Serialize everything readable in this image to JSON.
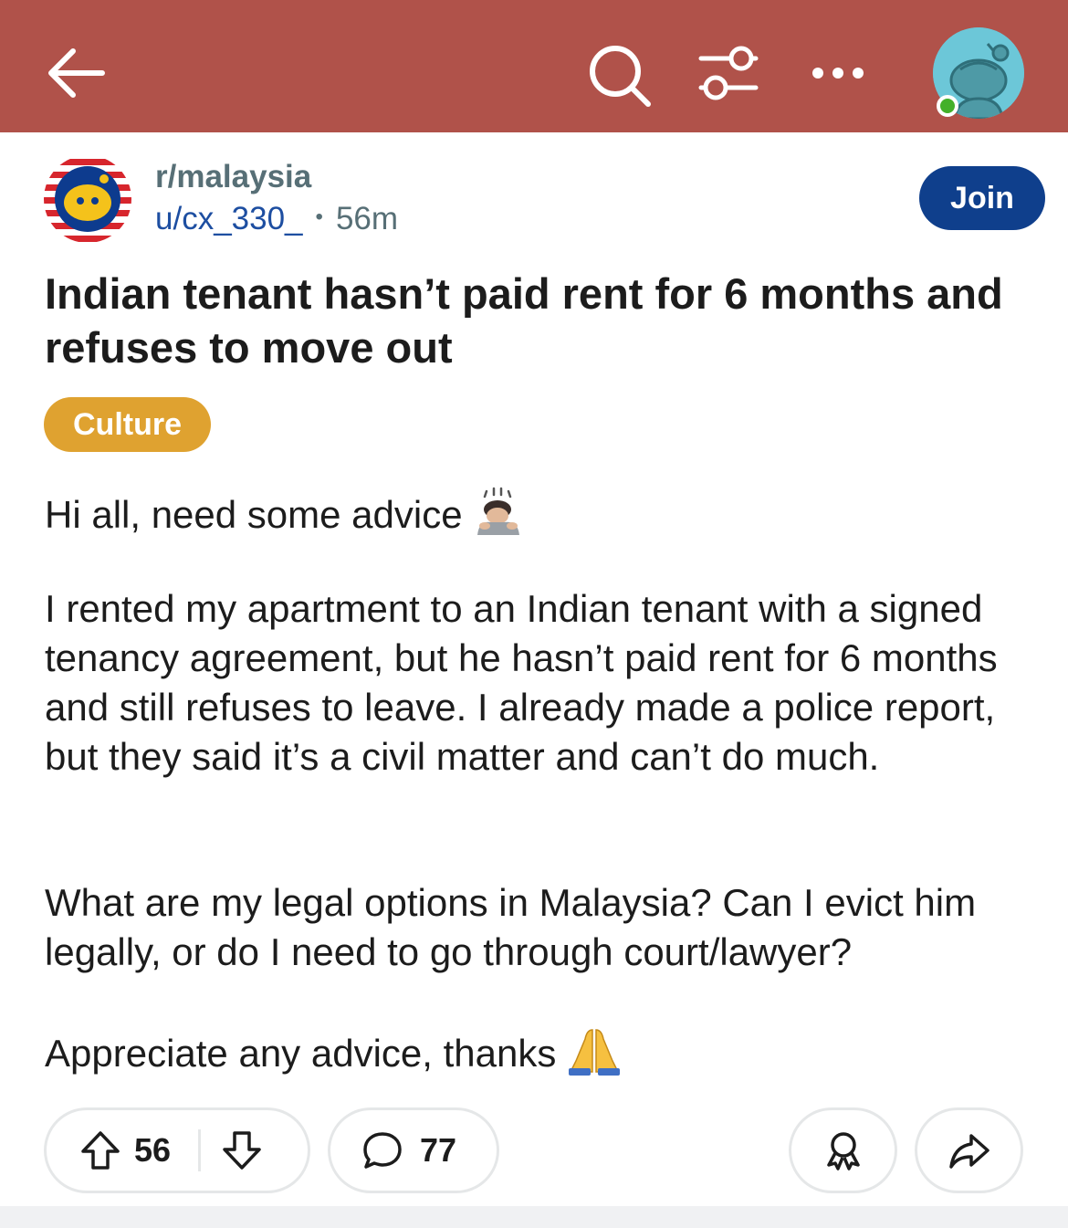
{
  "colors": {
    "topbar": "#b0524a",
    "join_button": "#0f3f8c",
    "flair": "#dfa230",
    "author": "#1d4ea1",
    "meta": "#576f76"
  },
  "topbar": {
    "icons": [
      "back-arrow-icon",
      "search-icon",
      "filter-icon",
      "more-icon",
      "avatar"
    ]
  },
  "post": {
    "subreddit": "r/malaysia",
    "author": "u/cx_330_",
    "separator": "•",
    "time_ago": "56m",
    "join_label": "Join",
    "title": "Indian tenant hasn’t paid rent for 6 months and refuses to move out",
    "flair": "Culture",
    "body": [
      "Hi all, need some advice",
      "I rented my apartment to an Indian tenant with a signed tenancy agreement, but he hasn’t paid rent for 6 months and still refuses to leave. I already made a police report, but they said it’s a civil matter and can’t do much.",
      "What are my legal options in Malaysia? Can I evict him legally, or do I need to go through court/lawyer?",
      "Appreciate any advice, thanks"
    ]
  },
  "actions": {
    "upvotes": "56",
    "comments": "77"
  }
}
